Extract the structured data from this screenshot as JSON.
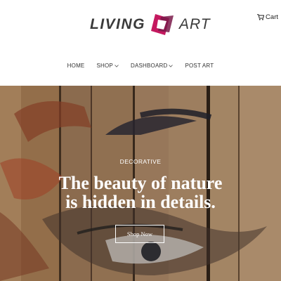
{
  "header": {
    "logo": {
      "left": "LIVING",
      "right": "ART"
    },
    "cart": {
      "label": "Cart",
      "icon": "cart-icon"
    },
    "nav": [
      {
        "label": "HOME",
        "dropdown": false
      },
      {
        "label": "SHOP",
        "dropdown": true
      },
      {
        "label": "DASHBOARD",
        "dropdown": true
      },
      {
        "label": "POST ART",
        "dropdown": false
      }
    ]
  },
  "hero": {
    "kicker": "DECORATIVE",
    "title_line1": "The beauty of nature",
    "title_line2": "is hidden in details.",
    "button": "Shop Now"
  },
  "colors": {
    "brand_accent": "#c4195f",
    "brand_accent_dark": "#7a1a4a",
    "text_dark": "#333333",
    "hero_text": "#ffffff"
  }
}
